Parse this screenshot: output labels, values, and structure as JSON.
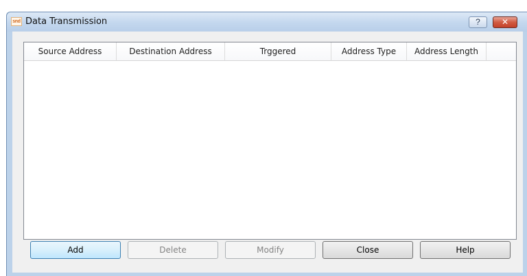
{
  "window": {
    "title": "Data Transmission",
    "app_icon_text": "snd",
    "help_glyph": "?",
    "close_glyph": "✕"
  },
  "table": {
    "columns": [
      "Source Address",
      "Destination Address",
      "Trggered",
      "Address Type",
      "Address Length"
    ],
    "rows": []
  },
  "buttons": {
    "add": {
      "label": "Add",
      "enabled": true,
      "default": true
    },
    "delete": {
      "label": "Delete",
      "enabled": false
    },
    "modify": {
      "label": "Modify",
      "enabled": false
    },
    "close": {
      "label": "Close",
      "enabled": true
    },
    "help": {
      "label": "Help",
      "enabled": true
    }
  },
  "colors": {
    "title_bar": "#c3d7ee",
    "close_button": "#c4412a",
    "client_bg": "#f0f0f0",
    "default_button_border": "#3c7fb1"
  }
}
